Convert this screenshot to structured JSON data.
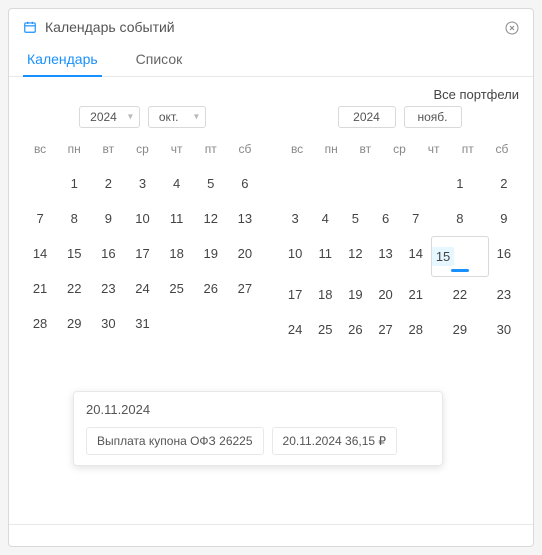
{
  "header": {
    "title": "Календарь событий"
  },
  "tabs": {
    "calendar": "Календарь",
    "list": "Список"
  },
  "portfolios_link": "Все портфели",
  "weekdays": [
    "вс",
    "пн",
    "вт",
    "ср",
    "чт",
    "пт",
    "сб"
  ],
  "left": {
    "year": "2024",
    "month": "окт.",
    "days": [
      "",
      "1",
      "2",
      "3",
      "4",
      "5",
      "6",
      "7",
      "8",
      "9",
      "10",
      "11",
      "12",
      "13",
      "14",
      "15",
      "16",
      "17",
      "18",
      "19",
      "20",
      "21",
      "22",
      "23",
      "24",
      "25",
      "26",
      "27",
      "28",
      "29",
      "30",
      "31"
    ]
  },
  "right": {
    "year": "2024",
    "month": "нояб.",
    "days": [
      "",
      "",
      "",
      "",
      "",
      "1",
      "2",
      "3",
      "4",
      "5",
      "6",
      "7",
      "8",
      "9",
      "10",
      "11",
      "12",
      "13",
      "14",
      "15",
      "16",
      "17",
      "18",
      "19",
      "20",
      "21",
      "22",
      "23",
      "24",
      "25",
      "26",
      "27",
      "28",
      "29",
      "30"
    ],
    "selected_index": 19
  },
  "tooltip": {
    "date": "20.11.2024",
    "event_label": "Выплата купона ОФЗ 26225",
    "event_detail": "20.11.2024 36,15 ₽"
  }
}
